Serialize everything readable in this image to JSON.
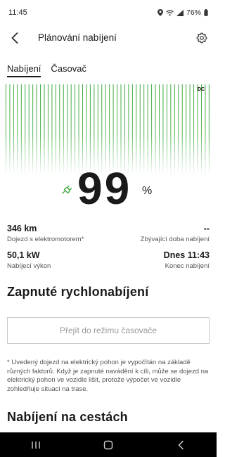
{
  "status_bar": {
    "time": "11:45",
    "battery": "76%",
    "icons": [
      "location-icon",
      "wifi-icon",
      "signal-icon",
      "battery-icon"
    ]
  },
  "header": {
    "title": "Plánování nabíjení",
    "back_icon": "back-arrow-icon",
    "settings_icon": "gear-icon"
  },
  "tabs": [
    {
      "label": "Nabíjení",
      "active": true
    },
    {
      "label": "Časovač",
      "active": false
    }
  ],
  "charge_chart": {
    "dc_label": "DC",
    "bar_color": "#3aa83a"
  },
  "charge_level": {
    "value": "99",
    "unit": "%",
    "plug_icon": "plug-icon",
    "accent_color": "#3aa83a"
  },
  "stats": {
    "range": {
      "value": "346 km",
      "label": "Dojezd s elektromotorem*"
    },
    "remaining_time": {
      "value": "--",
      "label": "Zbývající doba nabíjení"
    },
    "power": {
      "value": "50,1 kW",
      "label": "Nabíjecí výkon"
    },
    "end_time": {
      "value": "Dnes 11:43",
      "label": "Konec nabíjení"
    }
  },
  "fast_charge": {
    "title": "Zapnuté rychlonabíjení",
    "button_label": "Přejít do režimu časovače"
  },
  "footnote": "* Uvedený dojezd na elektrický pohon je vypočítán na základě různých faktorů. Když je zapnuté navádění k cíli, může se dojezd na elektrický pohon ve vozidle lišit, protože výpočet ve vozidle zohledňuje situaci na trase.",
  "on_road": {
    "title": "Nabíjení na cestách"
  },
  "nav_bar": {
    "icons": [
      "recents-icon",
      "home-icon",
      "back-icon"
    ]
  }
}
